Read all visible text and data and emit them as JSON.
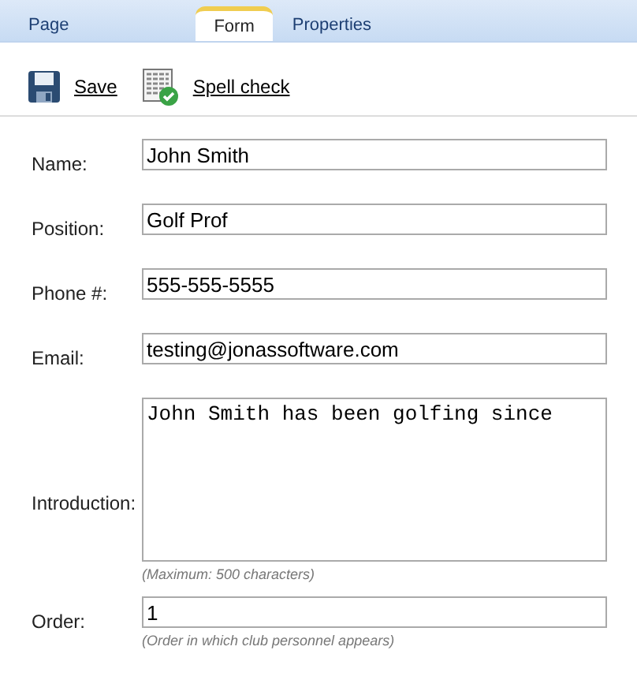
{
  "tabs": [
    {
      "label": "Page",
      "selected": false
    },
    {
      "label": "Form",
      "selected": true
    },
    {
      "label": "Properties",
      "selected": false
    }
  ],
  "toolbar": [
    {
      "kind": "save",
      "label": "Save"
    },
    {
      "kind": "spell",
      "label": "Spell check"
    }
  ],
  "fields": [
    {
      "kind": "text",
      "label": "Name:",
      "value": "John Smith"
    },
    {
      "kind": "text",
      "label": "Position:",
      "value": "Golf Prof"
    },
    {
      "kind": "text",
      "label": "Phone #:",
      "value": "555-555-5555"
    },
    {
      "kind": "text",
      "label": "Email:",
      "value": "testing@jonassoftware.com"
    },
    {
      "kind": "textarea",
      "label": "Introduction:",
      "value": "John Smith has been golfing since",
      "hint": "(Maximum: 500 characters)"
    },
    {
      "kind": "text",
      "label": "Order:",
      "value": "1",
      "hint": "(Order in which club personnel appears)"
    }
  ]
}
